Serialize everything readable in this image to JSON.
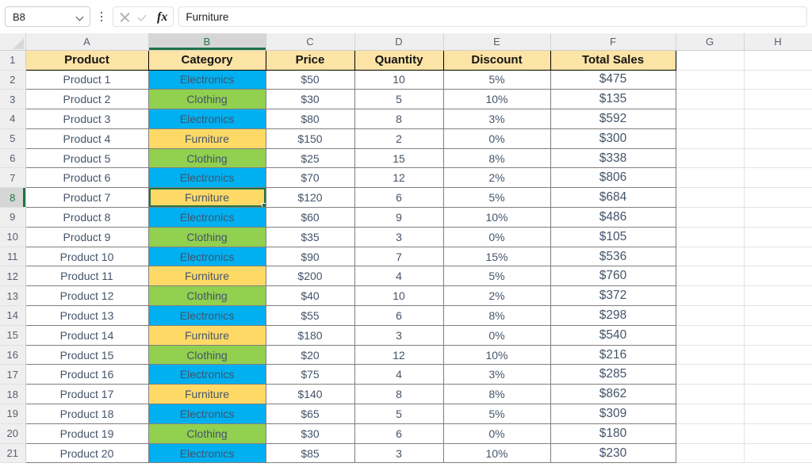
{
  "app": {
    "name_box_value": "B8",
    "formula_value": "Furniture",
    "icons": {
      "dropdown": "chevron-down-icon",
      "kebab": "more-options-icon",
      "cancel": "cancel-icon",
      "enter": "confirm-check-icon",
      "function": "fx"
    }
  },
  "grid": {
    "column_letters": [
      "A",
      "B",
      "C",
      "D",
      "E",
      "F",
      "G",
      "H"
    ],
    "active_column": "B",
    "active_row": 8,
    "selected_cell": "B8",
    "row_numbers": [
      1,
      2,
      3,
      4,
      5,
      6,
      7,
      8,
      9,
      10,
      11,
      12,
      13,
      14,
      15,
      16,
      17,
      18,
      19,
      20,
      21
    ],
    "headers": [
      "Product",
      "Category",
      "Price",
      "Quantity",
      "Discount",
      "Total Sales"
    ],
    "category_colors": {
      "Electronics": "#00b0f0",
      "Clothing": "#92d050",
      "Furniture": "#ffd966"
    },
    "header_fill": "#fce4a6",
    "selection_color": "#217346",
    "rows": [
      {
        "product": "Product 1",
        "category": "Electronics",
        "price": "$50",
        "quantity": "10",
        "discount": "5%",
        "total": "$475"
      },
      {
        "product": "Product 2",
        "category": "Clothing",
        "price": "$30",
        "quantity": "5",
        "discount": "10%",
        "total": "$135"
      },
      {
        "product": "Product 3",
        "category": "Electronics",
        "price": "$80",
        "quantity": "8",
        "discount": "3%",
        "total": "$592"
      },
      {
        "product": "Product 4",
        "category": "Furniture",
        "price": "$150",
        "quantity": "2",
        "discount": "0%",
        "total": "$300"
      },
      {
        "product": "Product 5",
        "category": "Clothing",
        "price": "$25",
        "quantity": "15",
        "discount": "8%",
        "total": "$338"
      },
      {
        "product": "Product 6",
        "category": "Electronics",
        "price": "$70",
        "quantity": "12",
        "discount": "2%",
        "total": "$806"
      },
      {
        "product": "Product 7",
        "category": "Furniture",
        "price": "$120",
        "quantity": "6",
        "discount": "5%",
        "total": "$684"
      },
      {
        "product": "Product 8",
        "category": "Electronics",
        "price": "$60",
        "quantity": "9",
        "discount": "10%",
        "total": "$486"
      },
      {
        "product": "Product 9",
        "category": "Clothing",
        "price": "$35",
        "quantity": "3",
        "discount": "0%",
        "total": "$105"
      },
      {
        "product": "Product 10",
        "category": "Electronics",
        "price": "$90",
        "quantity": "7",
        "discount": "15%",
        "total": "$536"
      },
      {
        "product": "Product 11",
        "category": "Furniture",
        "price": "$200",
        "quantity": "4",
        "discount": "5%",
        "total": "$760"
      },
      {
        "product": "Product 12",
        "category": "Clothing",
        "price": "$40",
        "quantity": "10",
        "discount": "2%",
        "total": "$372"
      },
      {
        "product": "Product 13",
        "category": "Electronics",
        "price": "$55",
        "quantity": "6",
        "discount": "8%",
        "total": "$298"
      },
      {
        "product": "Product 14",
        "category": "Furniture",
        "price": "$180",
        "quantity": "3",
        "discount": "0%",
        "total": "$540"
      },
      {
        "product": "Product 15",
        "category": "Clothing",
        "price": "$20",
        "quantity": "12",
        "discount": "10%",
        "total": "$216"
      },
      {
        "product": "Product 16",
        "category": "Electronics",
        "price": "$75",
        "quantity": "4",
        "discount": "3%",
        "total": "$285"
      },
      {
        "product": "Product 17",
        "category": "Furniture",
        "price": "$140",
        "quantity": "8",
        "discount": "8%",
        "total": "$862"
      },
      {
        "product": "Product 18",
        "category": "Electronics",
        "price": "$65",
        "quantity": "5",
        "discount": "5%",
        "total": "$309"
      },
      {
        "product": "Product 19",
        "category": "Clothing",
        "price": "$30",
        "quantity": "6",
        "discount": "0%",
        "total": "$180"
      },
      {
        "product": "Product 20",
        "category": "Electronics",
        "price": "$85",
        "quantity": "3",
        "discount": "10%",
        "total": "$230"
      }
    ]
  }
}
